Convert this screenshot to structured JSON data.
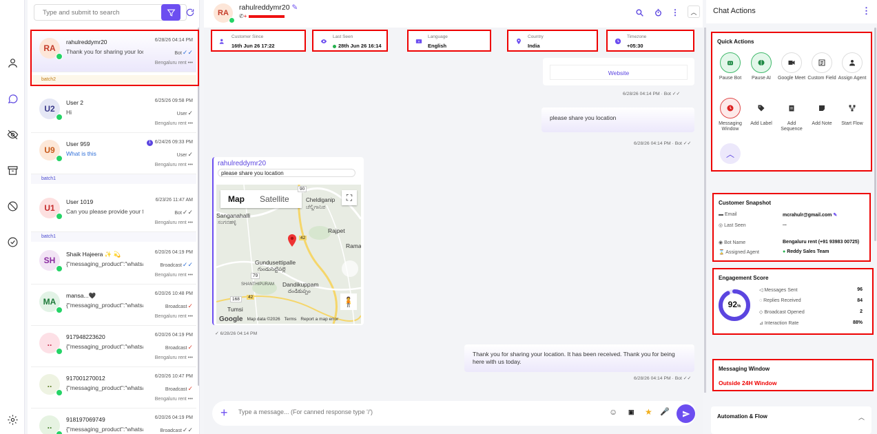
{
  "search": {
    "placeholder": "Type and submit to search"
  },
  "chats": [
    {
      "initials": "RA",
      "name": "rahulreddymr20",
      "message": "Thank you for sharing your loc",
      "time": "6/28/26 04:14 PM",
      "tag": "Bot",
      "location": "Bengaluru rent",
      "avatar_bg": "#fde6d8",
      "avatar_fg": "#c43c2a"
    },
    {
      "initials": "U2",
      "name": "User 2",
      "message": "Hi",
      "time": "6/25/26 09:58 PM",
      "tag": "User",
      "location": "Bengaluru rent",
      "avatar_bg": "#e5e7f5",
      "avatar_fg": "#3a3a8a"
    },
    {
      "initials": "U9",
      "name": "User 959",
      "message": "What is this",
      "time": "6/24/26 09:33 PM",
      "unread": "1",
      "tag": "User",
      "location": "Bengaluru rent",
      "avatar_bg": "#fde8d8",
      "avatar_fg": "#c85a1a"
    },
    {
      "initials": "U1",
      "name": "User 1019",
      "message": "Can you please provide your fu",
      "time": "6/23/26 11:47 AM",
      "tag": "Bot",
      "location": "Bengaluru rent",
      "avatar_bg": "#fde0e0",
      "avatar_fg": "#c42a2a"
    },
    {
      "initials": "SH",
      "name": "Shaik Hajeera ✨ 💫",
      "message": "{\"messaging_product\":\"whatsapp",
      "time": "6/20/26 04:19 PM",
      "tag": "Broadcast",
      "location": "Bengaluru rent",
      "avatar_bg": "#f2e4f5",
      "avatar_fg": "#8a2aa0"
    },
    {
      "initials": "MA",
      "name": "mansa...🖤",
      "message": "{\"messaging_product\":\"whatsapp",
      "time": "6/20/26 10:48 PM",
      "tag": "Broadcast",
      "location": "Bengaluru rent",
      "avatar_bg": "#e2f3e6",
      "avatar_fg": "#1e7a3a"
    },
    {
      "initials": "..",
      "name": "917948223620",
      "message": "{\"messaging_product\":\"whatsapp",
      "time": "6/20/26 04:19 PM",
      "tag": "Broadcast",
      "location": "Bengaluru rent",
      "avatar_bg": "#fde0e6",
      "avatar_fg": "#c42a4a"
    },
    {
      "initials": "..",
      "name": "917001270012",
      "message": "{\"messaging_product\":\"whatsapp",
      "time": "6/20/26 10:47 PM",
      "tag": "Broadcast",
      "location": "Bengaluru rent",
      "avatar_bg": "#eef3e2",
      "avatar_fg": "#5a7a1e"
    },
    {
      "initials": "..",
      "name": "918197069749",
      "message": "{\"messaging_product\":\"whatsapp",
      "time": "6/20/26 04:19 PM",
      "tag": "Broadcast",
      "location": "",
      "avatar_bg": "#e6f3e2",
      "avatar_fg": "#3a7a1e"
    }
  ],
  "batches": [
    "batch2",
    "batch1",
    "batch1"
  ],
  "header": {
    "initials": "RA",
    "name": "rahulreddymr20",
    "phone": "+"
  },
  "info": [
    {
      "label": "Customer Since",
      "value": "16th Jun 26 17:22"
    },
    {
      "label": "Last Seen",
      "value": "28th Jun 26 16:14"
    },
    {
      "label": "Language",
      "value": "English"
    },
    {
      "label": "Country",
      "value": "India"
    },
    {
      "label": "Timezone",
      "value": "+05:30"
    }
  ],
  "conversation": {
    "website_label": "Website",
    "meta1": "6/28/26 04:14 PM · Bot",
    "out1": "please share you location",
    "meta2": "6/28/26 04:14 PM · Bot",
    "in_name": "rahulreddymr20",
    "in_msg": "please share you location",
    "map_tab_map": "Map",
    "map_tab_sat": "Satellite",
    "map_labels": [
      "Cheldiganip",
      "ಚೆಲ್ಡಿಗಾನಿಪ",
      "Sanganahalli",
      "ಸಂಗನಹಳ್ಳಿ",
      "Rajpet",
      "Rama",
      "Gundusettipalle",
      "గుండుసెట్టిపల్లె",
      "SHANTHIPURAM",
      "Dandikuppam",
      "దండికుప్పం",
      "Tumsi",
      "90",
      "42",
      "42",
      "168",
      "79"
    ],
    "map_footer": [
      "Google",
      "Map data ©2026",
      "Terms",
      "Report a map error"
    ],
    "meta3": "6/28/26 04:14 PM",
    "out2": "Thank you for sharing your location. It has been received. Thank you for being here with us today.",
    "meta4": "6/28/26 04:14 PM · Bot"
  },
  "composer": {
    "placeholder": "Type a message... (For canned response type '/')"
  },
  "right": {
    "title": "Chat Actions",
    "quick_title": "Quick Actions",
    "quick": [
      {
        "label": "Pause Bot"
      },
      {
        "label": "Pause AI"
      },
      {
        "label": "Google Meet"
      },
      {
        "label": "Custom Field"
      },
      {
        "label": "Assign Agent"
      },
      {
        "label": "Messaging Window"
      },
      {
        "label": "Add Label"
      },
      {
        "label": "Add Sequence"
      },
      {
        "label": "Add Note"
      },
      {
        "label": "Start Flow"
      }
    ],
    "snapshot_title": "Customer Snapshot",
    "snapshot": [
      {
        "label": "Email",
        "value": "mcrahulr@gmail.com"
      },
      {
        "label": "Last Seen",
        "value": "..."
      },
      {
        "label": "Bot Name",
        "value": "Bengaluru rent (+91 93983 00725)"
      },
      {
        "label": "Assigned Agent",
        "value": "Reddy Sales Team"
      }
    ],
    "engagement_title": "Engagement Score",
    "score": "92",
    "score_unit": "%",
    "score_value": 92,
    "engagement": [
      {
        "label": "Messages Sent",
        "value": "96"
      },
      {
        "label": "Replies Received",
        "value": "84"
      },
      {
        "label": "Broadcast Opened",
        "value": "2"
      },
      {
        "label": "Interaction Rate",
        "value": "88%"
      }
    ],
    "window_title": "Messaging Window",
    "window_status": "Outside 24H Window",
    "automation_title": "Automation & Flow"
  },
  "colors": {
    "accent": "#6c4ef0",
    "alert": "#e00000",
    "whatsapp": "#25d366"
  }
}
